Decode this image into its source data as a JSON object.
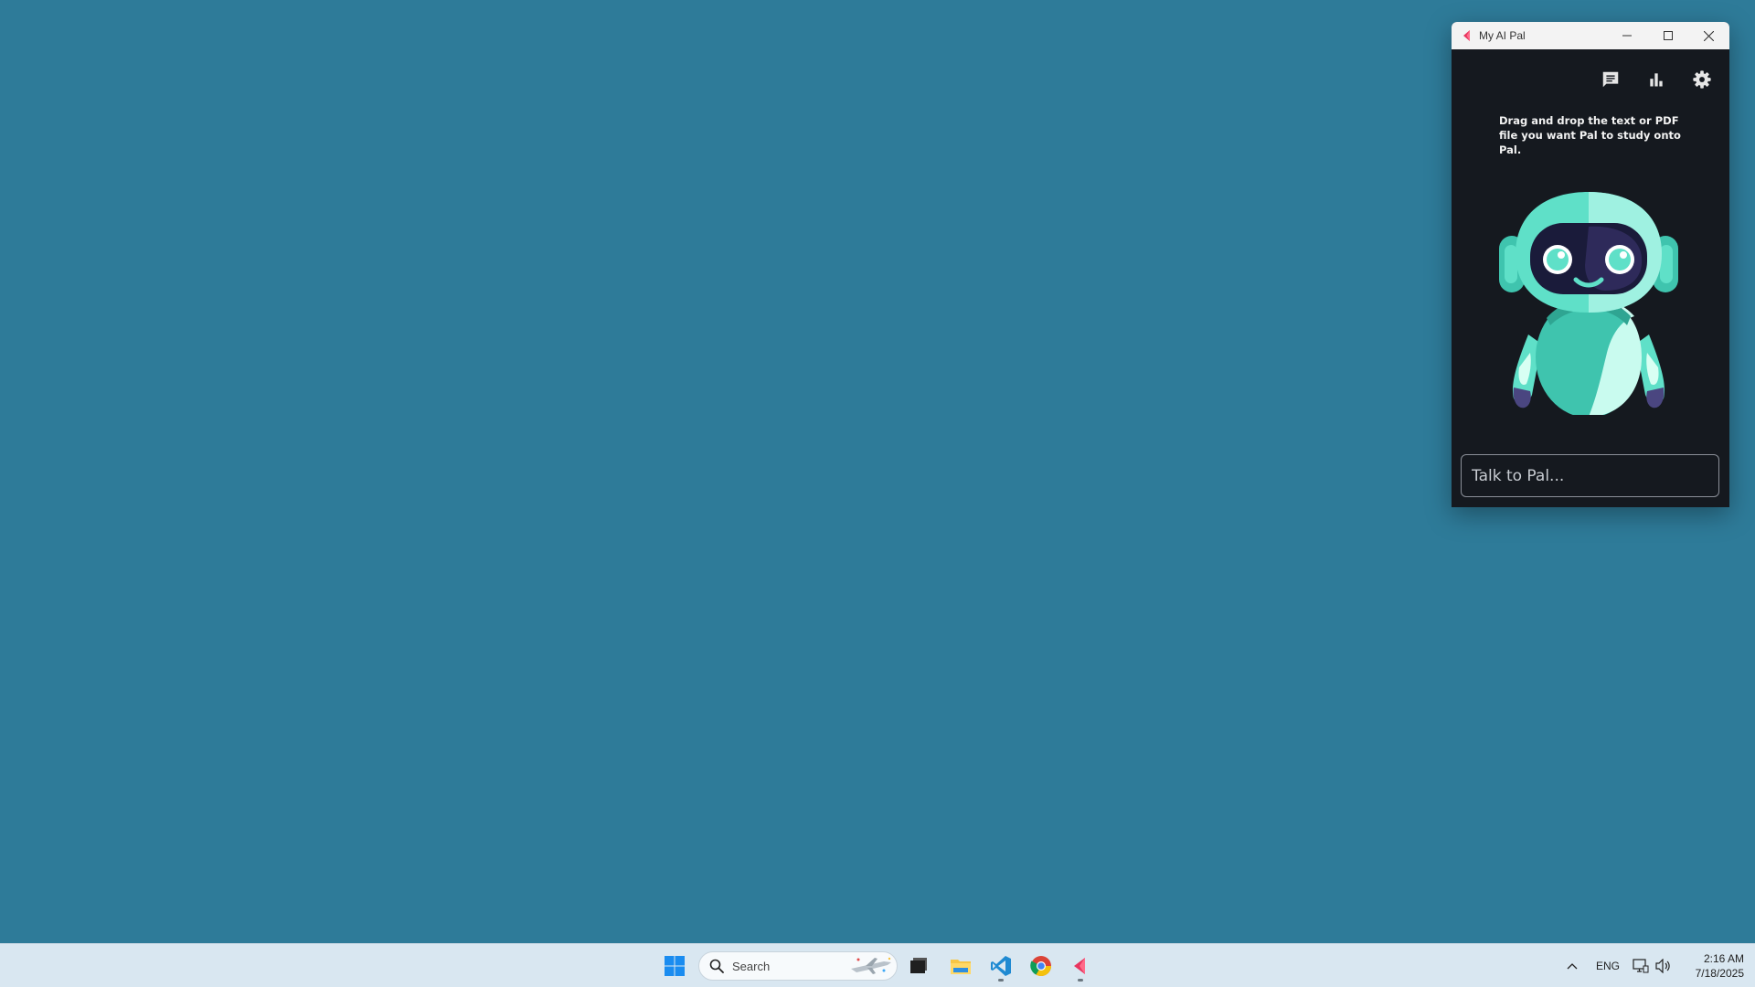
{
  "desktop": {
    "background_color": "#2e7b99"
  },
  "app_window": {
    "title": "My AI Pal",
    "controls": {
      "minimize": "minimize-icon",
      "maximize": "maximize-icon",
      "close": "close-icon"
    },
    "toolbar": {
      "chat": "chat-icon",
      "stats": "bar-chart-icon",
      "settings": "gear-icon"
    },
    "instruction": "Drag and drop the text or PDF file you want Pal to study onto Pal.",
    "input": {
      "placeholder": "Talk to Pal...",
      "value": ""
    },
    "colors": {
      "background": "#15191f",
      "accent_logo": "#e8355f",
      "robot_primary": "#5fe0c8"
    }
  },
  "taskbar": {
    "search_placeholder": "Search",
    "apps": [
      "windows-start-icon",
      "file-manager-icon",
      "file-explorer-icon",
      "vscode-icon",
      "chrome-icon",
      "my-ai-pal-icon"
    ],
    "tray": {
      "language": "ENG",
      "time": "2:16 AM",
      "date": "7/18/2025"
    }
  }
}
